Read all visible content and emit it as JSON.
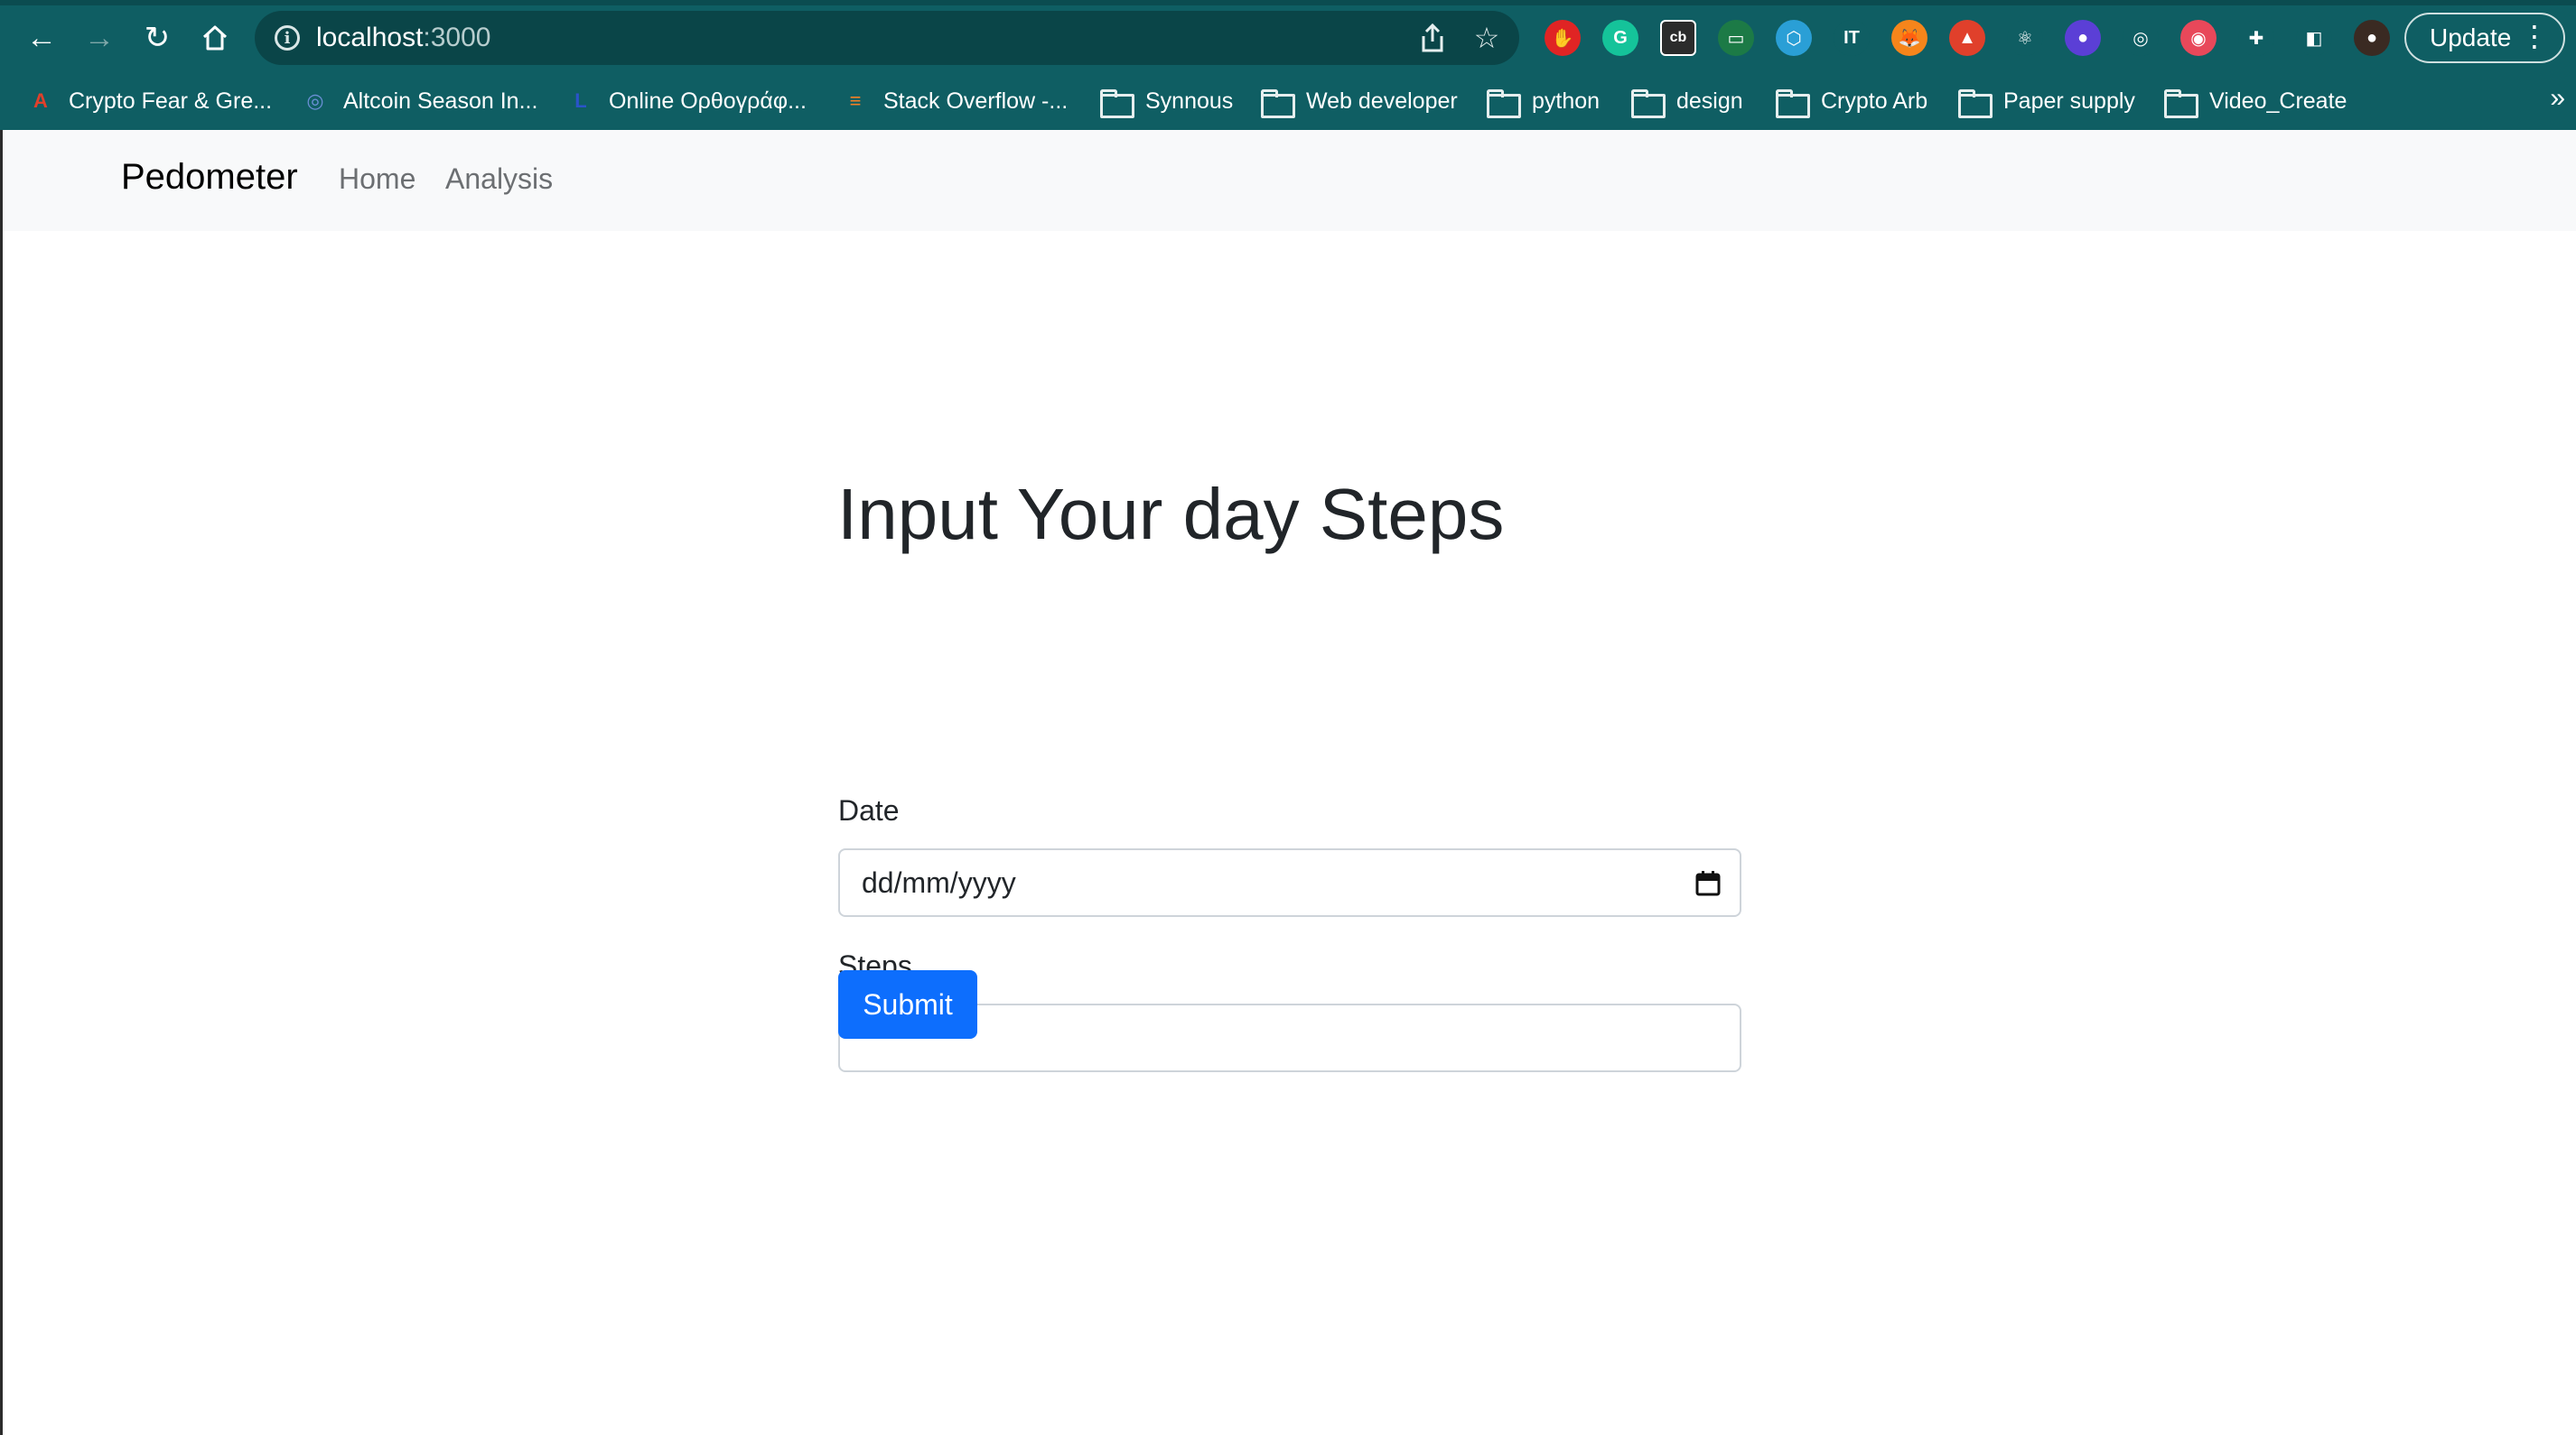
{
  "browser": {
    "url_host": "localhost",
    "url_port": ":3000",
    "update_label": "Update",
    "extensions": [
      {
        "icon": "adblock-icon",
        "color": "#e02424",
        "glyph": "✋"
      },
      {
        "icon": "grammarly-icon",
        "color": "#15c39a",
        "glyph": "G"
      },
      {
        "icon": "cb-icon",
        "color": "#2b2b2b",
        "glyph": "cb"
      },
      {
        "icon": "screen-capture-icon",
        "color": "#1c7a46",
        "glyph": "▭"
      },
      {
        "icon": "web3-icon",
        "color": "#2a9fd6",
        "glyph": "⬡"
      },
      {
        "icon": "translate-icon",
        "color": "#0f5e63",
        "glyph": "IT"
      },
      {
        "icon": "metamask-icon",
        "color": "#f6851b",
        "glyph": "🦊"
      },
      {
        "icon": "rocket-icon",
        "color": "#e0402b",
        "glyph": "▲"
      },
      {
        "icon": "react-devtools-icon",
        "color": "#0f5e63",
        "glyph": "⚛"
      },
      {
        "icon": "ghost-icon",
        "color": "#5b3fd6",
        "glyph": "●"
      },
      {
        "icon": "target-icon",
        "color": "#0f5e63",
        "glyph": "◎"
      },
      {
        "icon": "ball-icon",
        "color": "#e8485a",
        "glyph": "◉"
      },
      {
        "icon": "puzzle-icon",
        "color": "#0f5e63",
        "glyph": "✚"
      },
      {
        "icon": "sidepanel-icon",
        "color": "#0f5e63",
        "glyph": "◧"
      },
      {
        "icon": "avatar-icon",
        "color": "#3a2a22",
        "glyph": "●"
      }
    ]
  },
  "bookmarks": [
    {
      "label": "Crypto Fear & Gre...",
      "icon": "alternative-me-icon",
      "type": "site"
    },
    {
      "label": "Altcoin Season In...",
      "icon": "blockchaincenter-icon",
      "type": "site"
    },
    {
      "label": "Online Ορθογράφ...",
      "icon": "nl-icon",
      "type": "site"
    },
    {
      "label": "Stack Overflow -...",
      "icon": "stackoverflow-icon",
      "type": "site"
    },
    {
      "label": "Synnous",
      "icon": "folder-icon",
      "type": "folder"
    },
    {
      "label": "Web developer",
      "icon": "folder-icon",
      "type": "folder"
    },
    {
      "label": "python",
      "icon": "folder-icon",
      "type": "folder"
    },
    {
      "label": "design",
      "icon": "folder-icon",
      "type": "folder"
    },
    {
      "label": "Crypto Arb",
      "icon": "folder-icon",
      "type": "folder"
    },
    {
      "label": "Paper supply",
      "icon": "folder-icon",
      "type": "folder"
    },
    {
      "label": "Video_Create",
      "icon": "folder-icon",
      "type": "folder"
    }
  ],
  "bookmarks_more": "»",
  "navbar": {
    "brand": "Pedometer",
    "links": [
      "Home",
      "Analysis"
    ]
  },
  "form": {
    "title": "Input Your day Steps",
    "date_label": "Date",
    "date_placeholder": "dd/mm/yyyy",
    "steps_label": "Steps",
    "steps_value": "",
    "submit_label": "Submit"
  },
  "colors": {
    "chrome_bg": "#0f5e63",
    "navbar_bg": "#f8f9fa",
    "primary": "#0d6efd"
  }
}
